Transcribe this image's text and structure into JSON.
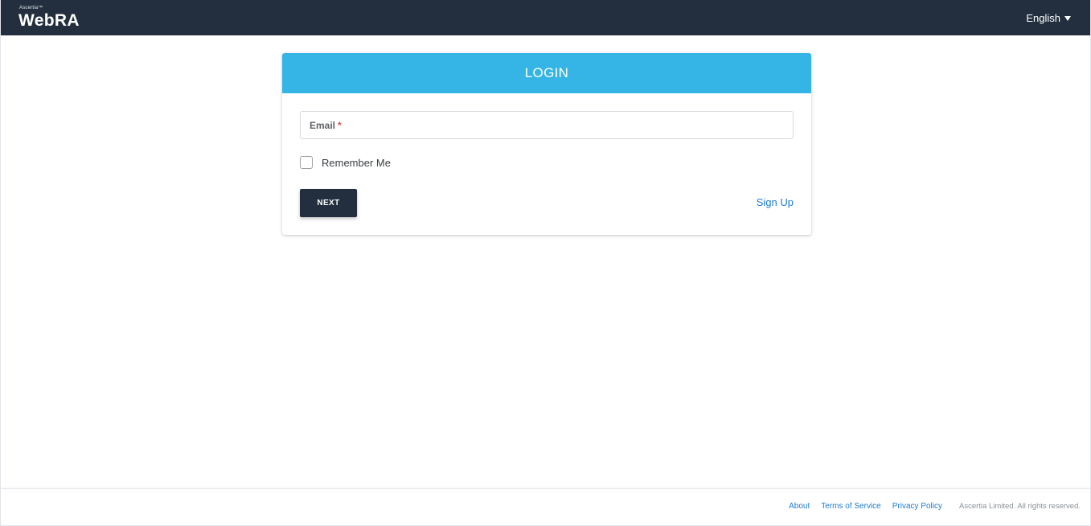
{
  "header": {
    "brand_small": "Ascertia™",
    "brand_main": "WebRA",
    "language": "English"
  },
  "login": {
    "title": "LOGIN",
    "email_label": "Email",
    "email_required_mark": "*",
    "email_value": "",
    "remember_label": "Remember Me",
    "remember_checked": false,
    "next_label": "NEXT",
    "signup_label": "Sign Up"
  },
  "footer": {
    "links": [
      "About",
      "Terms of Service",
      "Privacy Policy"
    ],
    "copyright": "Ascertia Limited. All rights reserved."
  },
  "colors": {
    "topbar": "#232f3e",
    "login_header": "#35b5e5",
    "link": "#1b7bd6",
    "required": "#d9534f"
  }
}
